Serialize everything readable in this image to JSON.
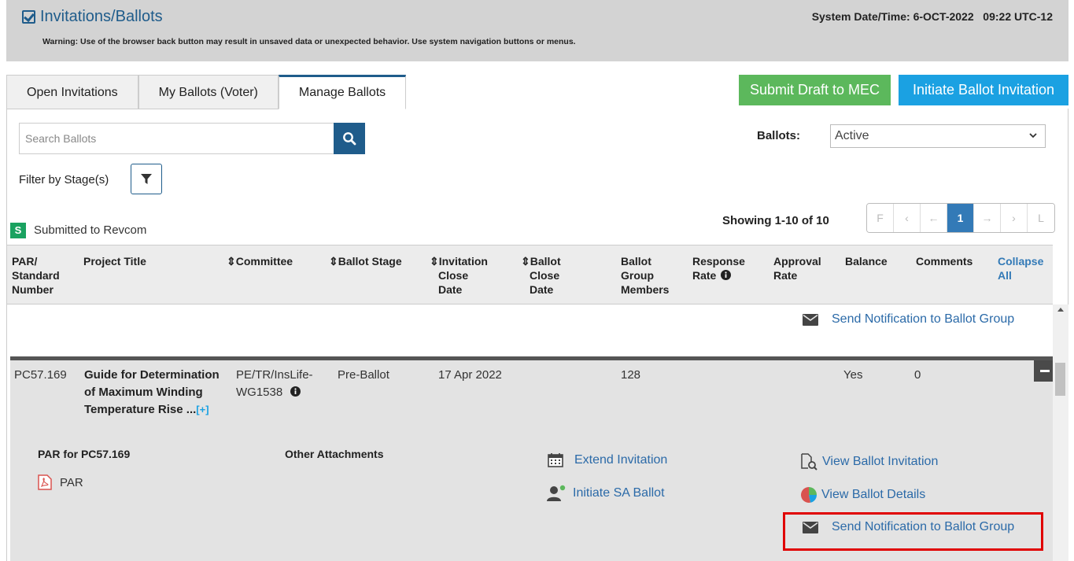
{
  "header": {
    "title": "Invitations/Ballots",
    "warning": "Warning: Use of the browser back button may result in unsaved data or unexpected behavior. Use system navigation buttons or menus.",
    "system_datetime": "System Date/Time: 6-OCT-2022   09:22 UTC-12"
  },
  "tabs": [
    {
      "label": "Open Invitations"
    },
    {
      "label": "My Ballots (Voter)"
    },
    {
      "label": "Manage Ballots"
    }
  ],
  "actions": {
    "submit_draft": "Submit Draft to MEC",
    "initiate_ballot": "Initiate Ballot Invitation"
  },
  "search": {
    "placeholder": "Search Ballots"
  },
  "ballots_filter": {
    "label": "Ballots:",
    "value": "Active"
  },
  "filter_stage": {
    "label": "Filter by Stage(s)"
  },
  "legend": {
    "badge": "S",
    "text": "Submitted to Revcom"
  },
  "pagination": {
    "showing": "Showing 1-10 of 10",
    "buttons": [
      "F",
      "‹",
      "←",
      "1",
      "→",
      "›",
      "L"
    ]
  },
  "table": {
    "headers": {
      "par": [
        "PAR/",
        "Standard",
        "Number"
      ],
      "title": "Project Title",
      "committee": "⇕Committee",
      "stage": "⇕Ballot Stage",
      "inv_close": [
        "⇕Invitation",
        "Close",
        "Date"
      ],
      "ballot_close": [
        "⇕Ballot",
        "Close",
        "Date"
      ],
      "group": [
        "Ballot",
        "Group",
        "Members"
      ],
      "response": [
        "Response",
        "Rate"
      ],
      "approval": [
        "Approval",
        "Rate"
      ],
      "balance": "Balance",
      "comments": "Comments",
      "collapse": [
        "Collapse",
        "All"
      ]
    },
    "row1": {
      "notify": "Send Notification to Ballot Group"
    },
    "row2": {
      "par": "PC57.169",
      "title": [
        "Guide for Determination",
        "of Maximum Winding",
        "Temperature Rise ..."
      ],
      "more": "[+]",
      "committee": [
        "PE/TR/InsLife-",
        "WG1538"
      ],
      "stage": "Pre-Ballot",
      "inv_close": "17 Apr 2022",
      "members": "128",
      "balance": "Yes",
      "comments": "0",
      "par_label": "PAR for PC57.169",
      "par_file": "PAR",
      "other_attachments": "Other Attachments",
      "extend": "Extend Invitation",
      "initiate_sa": "Initiate SA Ballot",
      "view_invitation": "View Ballot Invitation",
      "view_details": "View Ballot Details",
      "notify": "Send Notification to Ballot Group"
    }
  }
}
